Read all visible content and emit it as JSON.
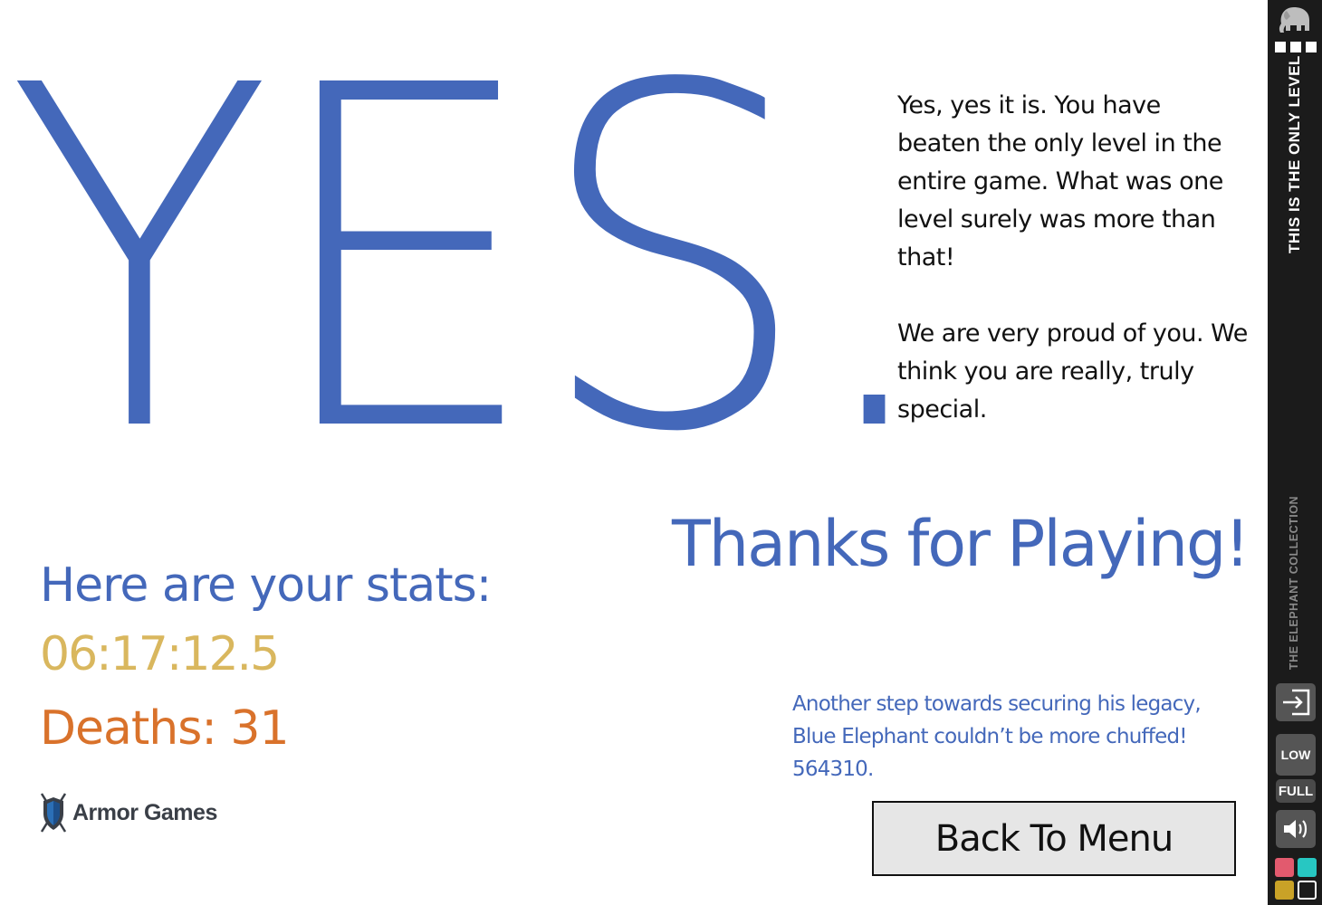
{
  "game": {
    "headline": "YES.",
    "message_paragraphs": [
      "Yes, yes it is.  You have beaten the only level in the entire game.  What was one level surely was more than that!",
      "We are very proud of you. We think you are really, truly special."
    ],
    "thanks": "Thanks for Playing!",
    "stats": {
      "heading": "Here are your stats:",
      "time": "06:17:12.5",
      "deaths": "Deaths: 31"
    },
    "legacy_lines": [
      "Another step towards securing his legacy,",
      "Blue Elephant couldn’t be more chuffed!",
      "564310."
    ],
    "back_button": "Back To Menu",
    "sponsor": "Armor Games"
  },
  "sidebar": {
    "title": "THIS IS THE ONLY LEVEL",
    "collection": "THE ELEPHANT COLLECTION",
    "low_label": "LOW",
    "full_label": "FULL",
    "color_swatches": [
      "#e25a6e",
      "#27c7c2",
      "#c9a227",
      "#1b1b1b"
    ]
  },
  "colors": {
    "primary_blue": "#4468ba",
    "time_gold": "#d9b75e",
    "deaths_orange": "#d9722b",
    "button_bg": "#e6e6e6"
  }
}
